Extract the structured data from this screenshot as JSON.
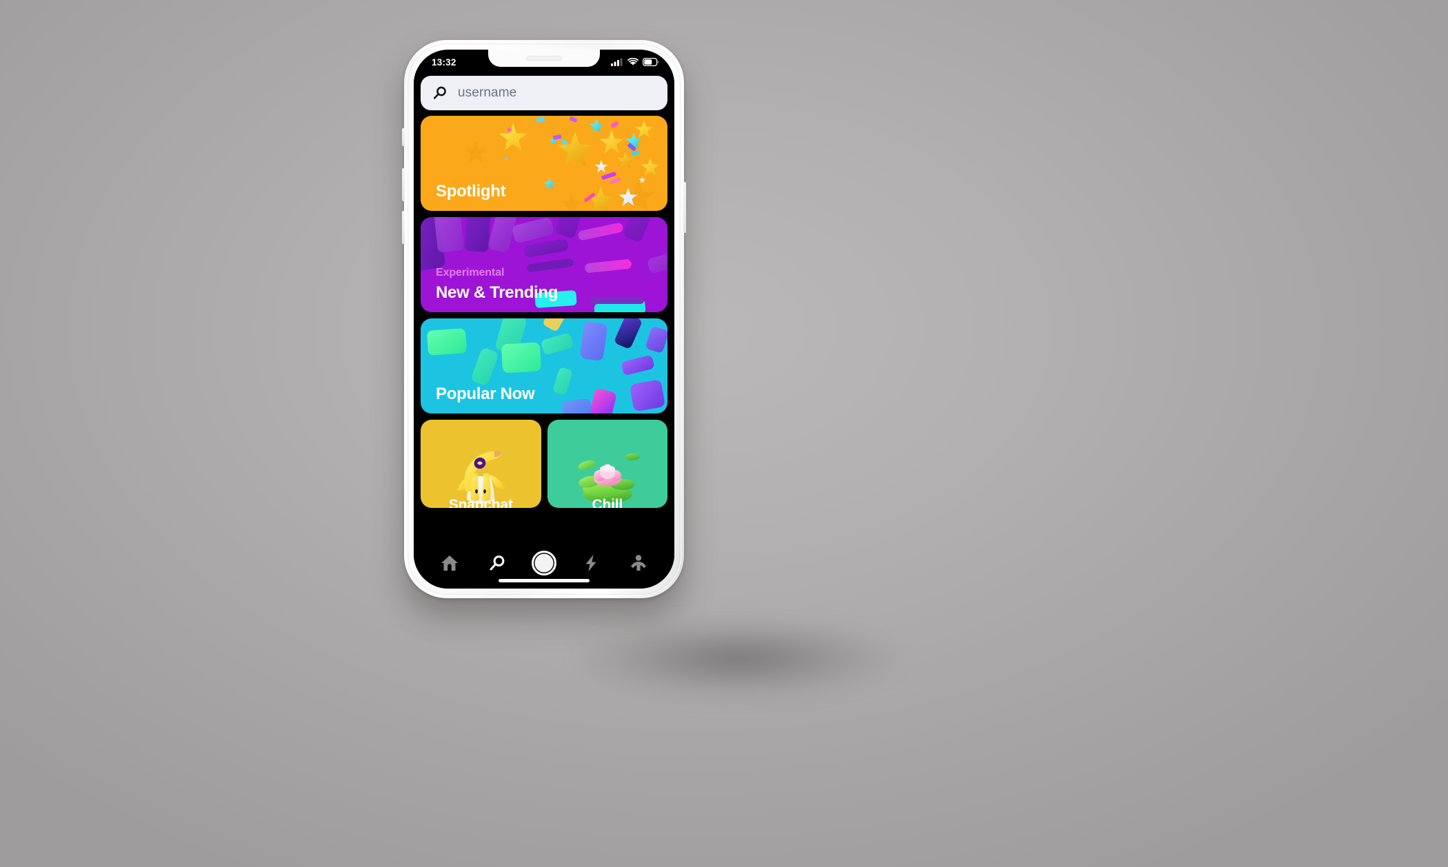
{
  "status_bar": {
    "time": "13:32",
    "icons": [
      "cellular-signal-icon",
      "wifi-icon",
      "battery-icon"
    ],
    "battery_level": 62
  },
  "search": {
    "icon": "search-icon",
    "placeholder": "username",
    "value": ""
  },
  "cards": [
    {
      "id": "spotlight",
      "label": "Spotlight",
      "kicker": "",
      "bg_color": "#fba81a",
      "art": "gold-stars-confetti"
    },
    {
      "id": "new-and-trending",
      "label": "New & Trending",
      "kicker": "Experimental",
      "kicker_color": "#e47ef0",
      "bg_color": "#9d14d6",
      "art": "purple-slabs"
    },
    {
      "id": "popular-now",
      "label": "Popular Now",
      "kicker": "",
      "bg_color": "#1cc4e2",
      "art": "floating-phones"
    }
  ],
  "card_row": [
    {
      "id": "banana",
      "label": "Snapchat",
      "bg_color": "#ecc32e",
      "art": "banana-character"
    },
    {
      "id": "chill",
      "label": "Chill",
      "bg_color": "#3fcc9b",
      "art": "lotus-lilypad"
    }
  ],
  "bottom_nav": {
    "items": [
      {
        "id": "home",
        "icon": "home-icon",
        "active": false
      },
      {
        "id": "discover",
        "icon": "search-icon",
        "active": true
      },
      {
        "id": "camera",
        "icon": "shutter-icon",
        "active": false
      },
      {
        "id": "stories",
        "icon": "lightning-icon",
        "active": false
      },
      {
        "id": "friends",
        "icon": "person-icon",
        "active": false
      }
    ]
  },
  "colors": {
    "screen_bg": "#000000",
    "search_bg": "#eef0f6",
    "search_placeholder": "#6e7280",
    "accent_orange": "#fba81a",
    "accent_purple": "#9d14d6",
    "accent_cyan": "#1cc4e2",
    "accent_yellow": "#ecc32e",
    "accent_green": "#3fcc9b",
    "nav_inactive": "#8a8a8a",
    "nav_active": "#ffffff"
  }
}
